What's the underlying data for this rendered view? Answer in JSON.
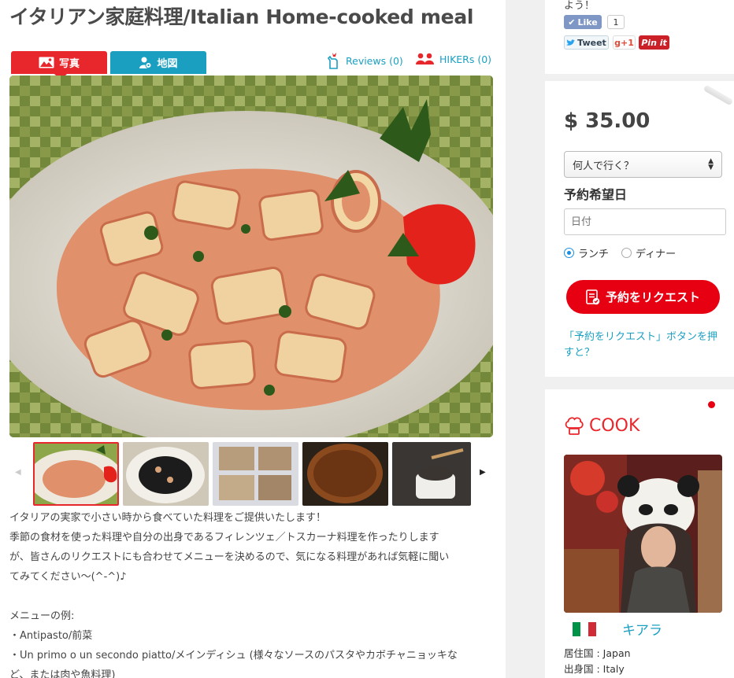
{
  "title": "イタリアン家庭料理/Italian Home-cooked meal",
  "tabs": {
    "photo": "写真",
    "map": "地図"
  },
  "links": {
    "reviews": "Reviews (0)",
    "hikers": "HIKERs (0)"
  },
  "description": [
    "イタリアの実家で小さい時から食べていた料理をご提供いたします！",
    "季節の食材を使った料理や自分の出身であるフィレンツェ／トスカーナ料理を作ったりします",
    "が、皆さんのリクエストにも合わせてメニューを決めるので、気になる料理があれば気軽に聞い",
    "てみてください〜(^-^)♪",
    "",
    "メニューの例:",
    "・Antipasto/前菜",
    "・Un primo o un secondo piatto/メインディシュ (様々なソースのパスタやカボチャニョッキな",
    "ど、または肉や魚料理)"
  ],
  "social": {
    "text": "よう！",
    "like": "Like",
    "like_count": "1",
    "tweet": "Tweet",
    "gplus": "g+1",
    "pin": "Pin it"
  },
  "booking": {
    "price": "$ 35.00",
    "people_select": "何人で行く？",
    "date_heading": "予約希望日",
    "date_placeholder": "日付",
    "lunch": "ランチ",
    "dinner": "ディナー",
    "request_button": "予約をリクエスト",
    "request_help": "「予約をリクエスト」ボタンを押すと？"
  },
  "cook": {
    "heading": "COOK",
    "name": "キアラ",
    "residence": "居住国 : Japan",
    "origin": "出身国 : Italy"
  },
  "colors": {
    "brand_red": "#e8272c",
    "link_blue": "#1b9fc1",
    "button_red": "#e60012"
  }
}
